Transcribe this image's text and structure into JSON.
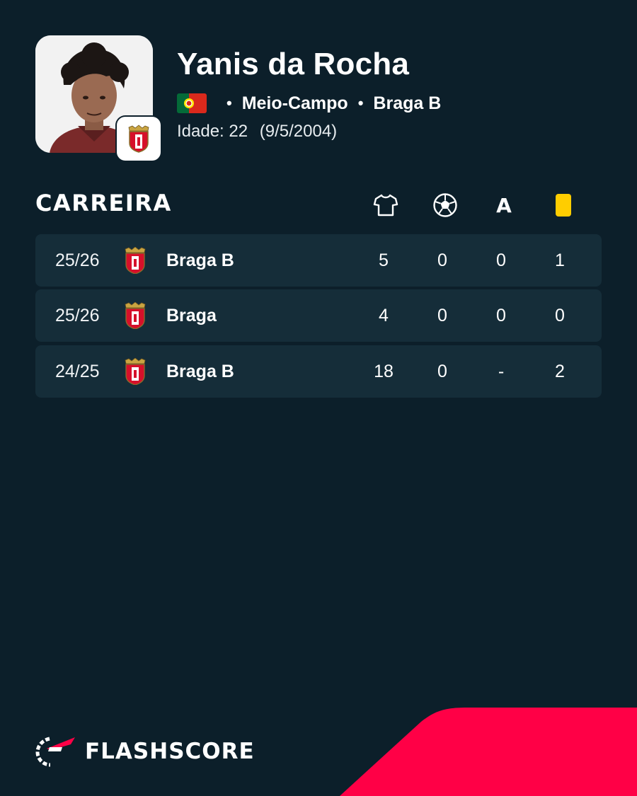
{
  "player": {
    "name": "Yanis da Rocha",
    "position": "Meio-Campo",
    "club": "Braga B",
    "age_label": "Idade: 22",
    "birth_date": "(9/5/2004)",
    "nationality_flag_icon": "portugal-flag-icon",
    "separator": "•"
  },
  "career": {
    "title": "CARREIRA",
    "columns": [
      {
        "name": "appearances",
        "icon": "shirt-icon"
      },
      {
        "name": "goals",
        "icon": "football-icon"
      },
      {
        "name": "assists",
        "label": "A"
      },
      {
        "name": "yellow_cards",
        "icon": "yellow-card-icon"
      }
    ],
    "rows": [
      {
        "season": "25/26",
        "club": "Braga B",
        "appearances": "5",
        "goals": "0",
        "assists": "0",
        "yellow_cards": "1"
      },
      {
        "season": "25/26",
        "club": "Braga",
        "appearances": "4",
        "goals": "0",
        "assists": "0",
        "yellow_cards": "0"
      },
      {
        "season": "24/25",
        "club": "Braga B",
        "appearances": "18",
        "goals": "0",
        "assists": "-",
        "yellow_cards": "2"
      }
    ]
  },
  "brand": {
    "name": "FLASHSCORE"
  },
  "colors": {
    "background": "#0c1f2a",
    "row_background": "#152d39",
    "accent": "#ff0046",
    "yellow_card": "#ffcd00"
  }
}
